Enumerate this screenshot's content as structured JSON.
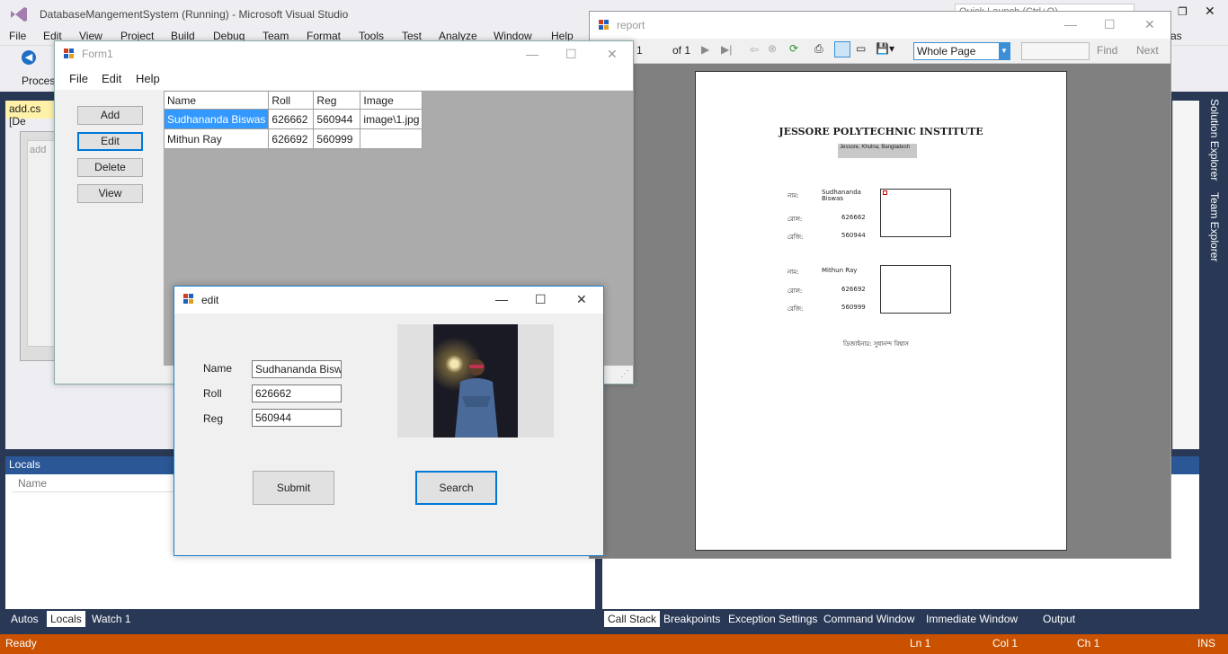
{
  "vs": {
    "title": "DatabaseMangementSystem (Running) - Microsoft Visual Studio",
    "menu": [
      "File",
      "Edit",
      "View",
      "Project",
      "Build",
      "Debug",
      "Team",
      "Format",
      "Tools",
      "Test",
      "Analyze",
      "Window",
      "Help"
    ],
    "quick_launch": "Quick Launch (Ctrl+Q)",
    "process_label": "Process",
    "doc_tab": "add.cs [De",
    "design_label": "add",
    "user_menu": "vas",
    "solution_explorer": "Solution Explorer",
    "team_explorer": "Team Explorer",
    "locals": {
      "title": "Locals",
      "col_name": "Name"
    },
    "bottom_tabs_left": [
      "Autos",
      "Locals",
      "Watch 1"
    ],
    "bottom_tabs_right": [
      "Call Stack",
      "Breakpoints",
      "Exception Settings",
      "Command Window",
      "Immediate Window",
      "Output"
    ],
    "status": {
      "ready": "Ready",
      "ln": "Ln 1",
      "col": "Col 1",
      "ch": "Ch 1",
      "ins": "INS"
    }
  },
  "report": {
    "title": "report",
    "page_num": "1",
    "page_of": "of 1",
    "zoom": "Whole Page",
    "find": "Find",
    "next": "Next",
    "header": "JESSORE POLYTECHNIC INSTITUTE",
    "address": "Jessore, Khulna, Bangladesh",
    "label_name": "নাম:",
    "label_roll": "রোল:",
    "label_reg": "রেজি:",
    "records": [
      {
        "name": "Sudhananda Biswas",
        "roll": "626662",
        "reg": "560944"
      },
      {
        "name": "Mithun Ray",
        "roll": "626692",
        "reg": "560999"
      }
    ],
    "footer": "ডিজাইনার: সুধানন্দ বিশ্বাস"
  },
  "form1": {
    "title": "Form1",
    "menu": [
      "File",
      "Edit",
      "Help"
    ],
    "buttons": {
      "add": "Add",
      "edit": "Edit",
      "delete": "Delete",
      "view": "View"
    },
    "grid": {
      "columns": [
        "Name",
        "Roll",
        "Reg",
        "Image"
      ],
      "rows": [
        [
          "Sudhananda Biswas",
          "626662",
          "560944",
          "image\\1.jpg"
        ],
        [
          "Mithun Ray",
          "626692",
          "560999",
          ""
        ]
      ]
    }
  },
  "edit": {
    "title": "edit",
    "labels": {
      "name": "Name",
      "roll": "Roll",
      "reg": "Reg"
    },
    "values": {
      "name": "Sudhananda Biswas",
      "roll": "626662",
      "reg": "560944"
    },
    "submit": "Submit",
    "search": "Search"
  },
  "colors": {
    "status_bar": "#ca5100",
    "selection": "#3399ff",
    "focus": "#0078d7",
    "vs_dark": "#293955"
  }
}
